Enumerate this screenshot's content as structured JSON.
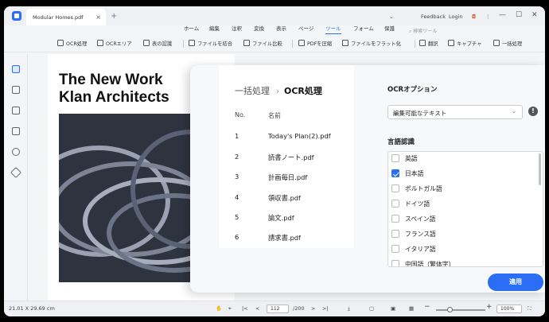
{
  "titlebar": {
    "doc_tab": "Modular Homes.pdf",
    "close_glyph": "×",
    "new_tab_glyph": "+",
    "feedback": "Feedback",
    "login": "Login",
    "search_placeholder": "検索ツール",
    "menu": [
      "ホーム",
      "編集",
      "注釈",
      "変換",
      "表示",
      "ページ",
      "ツール",
      "フォーム",
      "保護"
    ],
    "active_menu": "ツール"
  },
  "ribbon": {
    "items": [
      "OCR処理",
      "OCRエリア",
      "表の認識",
      "ファイルを結合",
      "ファイル比較",
      "PDFを圧縮",
      "ファイルをフラット化",
      "翻訳",
      "キャプチャ",
      "一括処理"
    ]
  },
  "page": {
    "title_line1": "The New Work",
    "title_line2": "Klan Architects"
  },
  "panel": {
    "breadcrumb_parent": "一括処理",
    "breadcrumb_sep": "›",
    "breadcrumb_current": "OCR処理",
    "col_no": "No.",
    "col_name": "名前",
    "files": [
      {
        "no": "1",
        "name": "Today's Plan(2).pdf"
      },
      {
        "no": "2",
        "name": "読書ノート.pdf"
      },
      {
        "no": "3",
        "name": "計画毎日.pdf"
      },
      {
        "no": "4",
        "name": "領収書.pdf"
      },
      {
        "no": "5",
        "name": "論文.pdf"
      },
      {
        "no": "6",
        "name": "請求書.pdf"
      }
    ],
    "options_title": "OCRオプション",
    "mode_value": "編集可能なテキスト",
    "info_glyph": "!",
    "lang_title": "言語認識",
    "languages": [
      {
        "label": "英語",
        "checked": false
      },
      {
        "label": "日本語",
        "checked": true
      },
      {
        "label": "ポルトガル語",
        "checked": false
      },
      {
        "label": "ドイツ語",
        "checked": false
      },
      {
        "label": "スペイン語",
        "checked": false
      },
      {
        "label": "フランス語",
        "checked": false
      },
      {
        "label": "イタリア語",
        "checked": false
      },
      {
        "label": "中国語（繁体字）",
        "checked": false
      }
    ],
    "apply_label": "適用"
  },
  "statusbar": {
    "dimensions": "21.01 X 29.69 cm",
    "current_page": "112",
    "total_pages": "/200",
    "zoom": "100%"
  },
  "colors": {
    "accent": "#2b6ef5"
  }
}
